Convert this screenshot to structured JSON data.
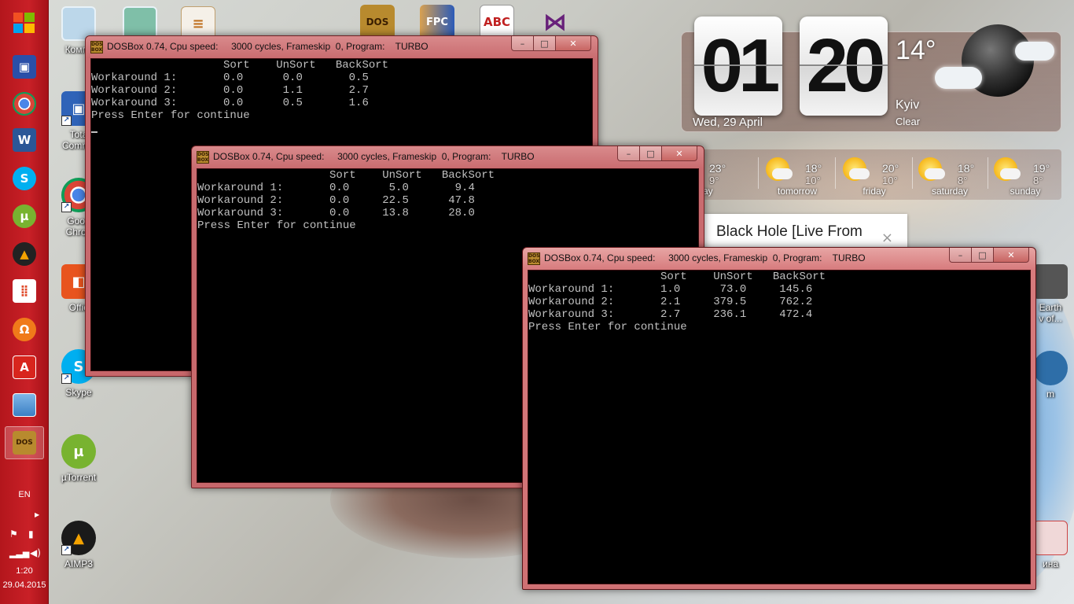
{
  "taskbar": {
    "items": [
      {
        "name": "windows-start",
        "icon": "windows-logo-icon"
      },
      {
        "name": "save-disk",
        "icon": "floppy-disk-icon"
      },
      {
        "name": "chrome",
        "icon": "chrome-icon"
      },
      {
        "name": "word",
        "icon": "word-icon"
      },
      {
        "name": "skype",
        "icon": "skype-icon"
      },
      {
        "name": "utorrent",
        "icon": "utorrent-icon"
      },
      {
        "name": "aimp",
        "icon": "aimp-icon"
      },
      {
        "name": "apps",
        "icon": "grid-apps-icon"
      },
      {
        "name": "headphones",
        "icon": "headphones-icon"
      },
      {
        "name": "acrobat",
        "icon": "acrobat-icon"
      },
      {
        "name": "photo-viewer",
        "icon": "photo-icon"
      },
      {
        "name": "dosbox",
        "icon": "dosbox-icon",
        "active": true
      }
    ],
    "language": "EN",
    "time": "1:20",
    "date": "29.04.2015"
  },
  "desktop_icons": [
    {
      "label": "Компь",
      "icon": "computer-icon"
    },
    {
      "label": "Tota",
      "label2": "Comma",
      "icon": "total-commander-icon"
    },
    {
      "label": "Goog",
      "label2": "Chron",
      "icon": "chrome-icon"
    },
    {
      "label": "Offic",
      "icon": "office-icon"
    },
    {
      "label": "Skype",
      "icon": "skype-icon"
    },
    {
      "label": "µTorrent",
      "icon": "utorrent-icon"
    },
    {
      "label": "AIMP3",
      "icon": "aimp-icon"
    },
    {
      "label": "Earth",
      "label2": "v of...",
      "icon": "earth-icon"
    },
    {
      "label": "m",
      "icon": "unknown-app-icon"
    },
    {
      "label": "ина",
      "icon": "unknown-app-icon"
    }
  ],
  "top_icons": [
    {
      "icon": "dosbox-icon",
      "text": "DOS"
    },
    {
      "icon": "free-pascal-icon",
      "text": "FPC"
    },
    {
      "icon": "abc-icon",
      "text": "ABC"
    },
    {
      "icon": "visual-studio-icon",
      "text": ""
    }
  ],
  "clock": {
    "hours": "01",
    "minutes": "20",
    "date": "Wed, 29 April",
    "temperature": "14°",
    "city": "Kyiv",
    "condition": "Clear"
  },
  "forecast": [
    {
      "day": "today",
      "hi": "23°",
      "lo": "9°"
    },
    {
      "day": "tomorrow",
      "hi": "18°",
      "lo": "10°"
    },
    {
      "day": "friday",
      "hi": "20°",
      "lo": "10°"
    },
    {
      "day": "saturday",
      "hi": "18°",
      "lo": "8°"
    },
    {
      "day": "sunday",
      "hi": "19°",
      "lo": "8°"
    }
  ],
  "notification": {
    "text": "Black Hole [Live From",
    "close": "×"
  },
  "windows": [
    {
      "title": "DOSBox 0.74, Cpu speed:     3000 cycles, Frameskip  0, Program:    TURBO",
      "console": "                    Sort    UnSort   BackSort\nWorkaround 1:       0.0      0.0       0.5\nWorkaround 2:       0.0      1.1       2.7\nWorkaround 3:       0.0      0.5       1.6\nPress Enter for continue"
    },
    {
      "title": "DOSBox 0.74, Cpu speed:     3000 cycles, Frameskip  0, Program:    TURBO",
      "console": "                    Sort    UnSort   BackSort\nWorkaround 1:       0.0      5.0       9.4\nWorkaround 2:       0.0     22.5      47.8\nWorkaround 3:       0.0     13.8      28.0\nPress Enter for continue"
    },
    {
      "title": "DOSBox 0.74, Cpu speed:     3000 cycles, Frameskip  0, Program:    TURBO",
      "console": "                    Sort    UnSort   BackSort\nWorkaround 1:       1.0      73.0     145.6\nWorkaround 2:       2.1     379.5     762.2\nWorkaround 3:       2.7     236.1     472.4\nPress Enter for continue"
    }
  ],
  "window_controls": {
    "minimize": "–",
    "maximize": "□",
    "close": "✕"
  },
  "colors": {
    "taskbar": "#c21e24",
    "window_frame": "#d27a7c",
    "console_bg": "#000000",
    "console_text": "#c0c0c0"
  }
}
